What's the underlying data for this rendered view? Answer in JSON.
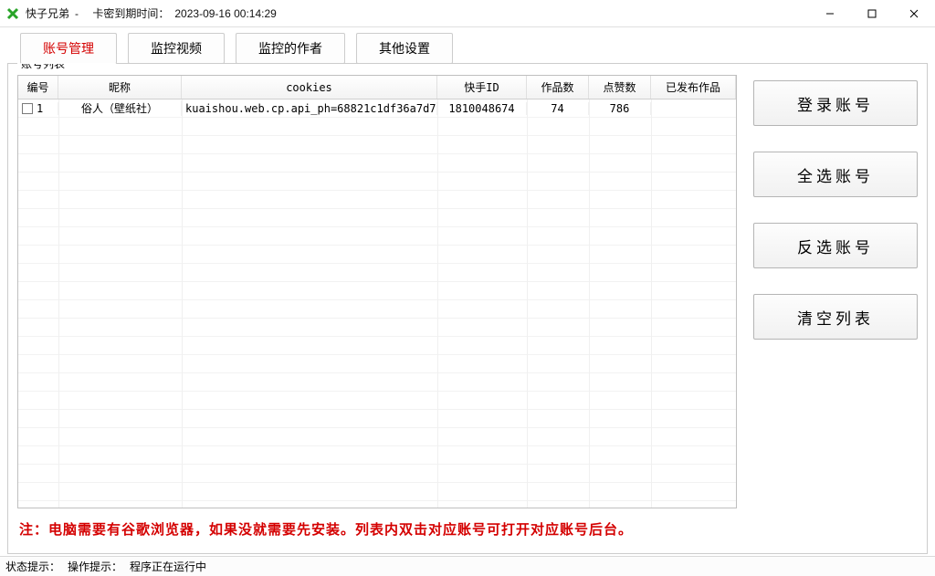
{
  "window": {
    "app_name": "快子兄弟",
    "separator": "-",
    "expiry_label": "卡密到期时间：",
    "expiry_value": "2023-09-16 00:14:29"
  },
  "tabs": [
    {
      "label": "账号管理",
      "active": true
    },
    {
      "label": "监控视频",
      "active": false
    },
    {
      "label": "监控的作者",
      "active": false
    },
    {
      "label": "其他设置",
      "active": false
    }
  ],
  "group_title": "账号列表",
  "table": {
    "headers": {
      "index": "编号",
      "nickname": "昵称",
      "cookies": "cookies",
      "ksid": "快手ID",
      "works": "作品数",
      "likes": "点赞数",
      "published": "已发布作品"
    },
    "rows": [
      {
        "checked": false,
        "index": "1",
        "nickname": "俗人（壁纸社）",
        "cookies": "kuaishou.web.cp.api_ph=68821c1df36a7d7...",
        "ksid": "1810048674",
        "works": "74",
        "likes": "786",
        "published": ""
      }
    ]
  },
  "buttons": {
    "login": "登录账号",
    "select_all": "全选账号",
    "invert": "反选账号",
    "clear": "清空列表"
  },
  "note": "注：电脑需要有谷歌浏览器，如果没就需要先安装。列表内双击对应账号可打开对应账号后台。",
  "statusbar": {
    "status_label": "状态提示：",
    "op_label": "操作提示：",
    "op_value": "程序正在运行中"
  }
}
